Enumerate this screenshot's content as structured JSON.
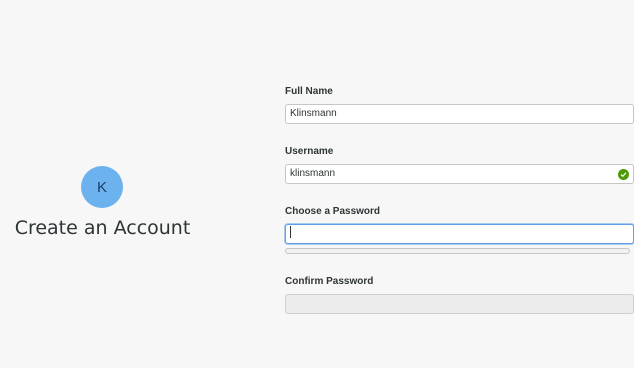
{
  "sidebar": {
    "avatar_initial": "K",
    "title": "Create an Account"
  },
  "form": {
    "full_name": {
      "label": "Full Name",
      "value": "Klinsmann"
    },
    "username": {
      "label": "Username",
      "value": "klinsmann",
      "status_icon": "check-circle-icon"
    },
    "password": {
      "label": "Choose a Password",
      "value": "",
      "strength": 0
    },
    "confirm": {
      "label": "Confirm Password",
      "value": ""
    }
  },
  "colors": {
    "accent": "#62a0ea",
    "success": "#4e9a06",
    "avatar": "#6cb2ee"
  }
}
